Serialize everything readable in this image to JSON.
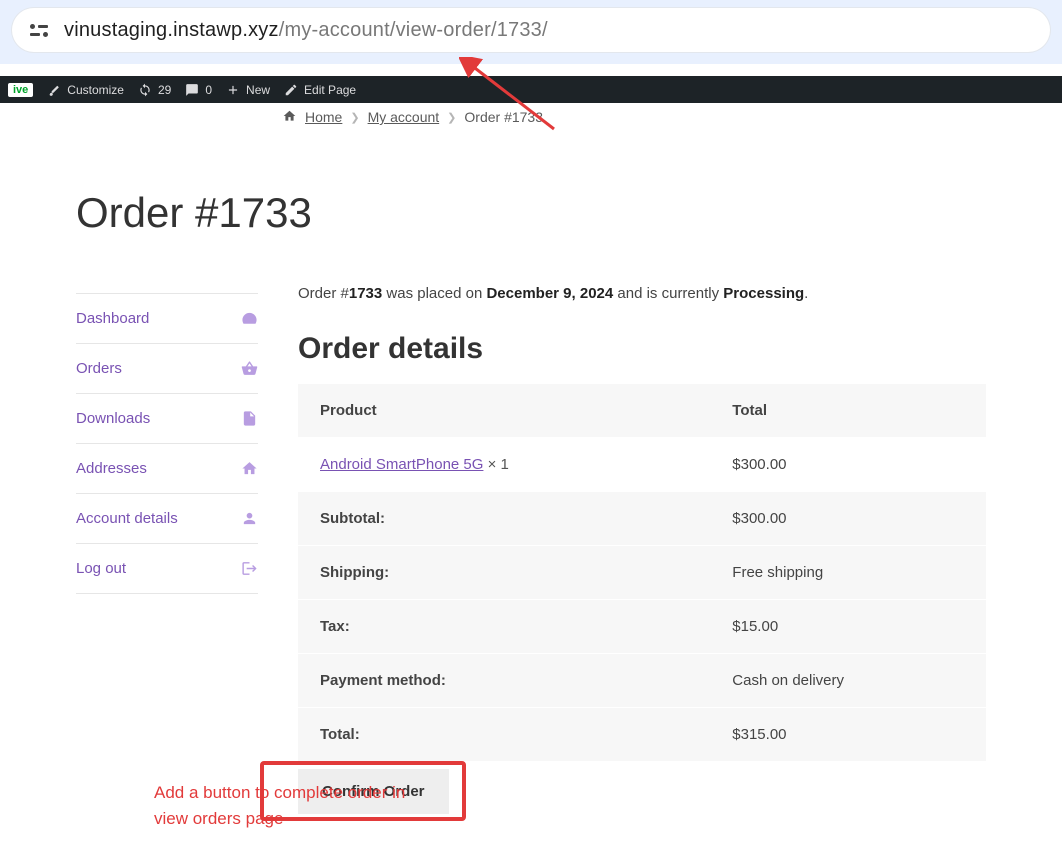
{
  "url": {
    "domain": "vinustaging.instawp.xyz",
    "path": "/my-account/view-order/1733/"
  },
  "adminbar": {
    "live": "ive",
    "customize": "Customize",
    "updates": "29",
    "comments": "0",
    "new": "New",
    "edit_page": "Edit Page"
  },
  "breadcrumb": {
    "home": "Home",
    "account": "My account",
    "current": "Order #1733"
  },
  "page_title": "Order #1733",
  "sidebar": [
    {
      "label": "Dashboard",
      "icon": "dashboard"
    },
    {
      "label": "Orders",
      "icon": "basket"
    },
    {
      "label": "Downloads",
      "icon": "file"
    },
    {
      "label": "Addresses",
      "icon": "home"
    },
    {
      "label": "Account details",
      "icon": "user"
    },
    {
      "label": "Log out",
      "icon": "logout"
    }
  ],
  "status_line": {
    "prefix": "Order #",
    "order_no": "1733",
    "mid1": " was placed on ",
    "date": "December 9, 2024",
    "mid2": " and is currently ",
    "status": "Processing",
    "end": "."
  },
  "details_heading": "Order details",
  "table": {
    "headers": {
      "product": "Product",
      "total": "Total"
    },
    "items": [
      {
        "name": "Android SmartPhone 5G",
        "qty": "× 1",
        "total": "$300.00"
      }
    ],
    "footer": [
      {
        "label": "Subtotal:",
        "value": "$300.00"
      },
      {
        "label": "Shipping:",
        "value": "Free shipping"
      },
      {
        "label": "Tax:",
        "value": "$15.00"
      },
      {
        "label": "Payment method:",
        "value": "Cash on delivery"
      },
      {
        "label": "Total:",
        "value": "$315.00"
      }
    ]
  },
  "confirm_label": "Confirm Order",
  "annotation_text": "Add a button to complete order in\nview orders page",
  "colors": {
    "link": "#7952b3",
    "highlight": "#e23a3a"
  }
}
